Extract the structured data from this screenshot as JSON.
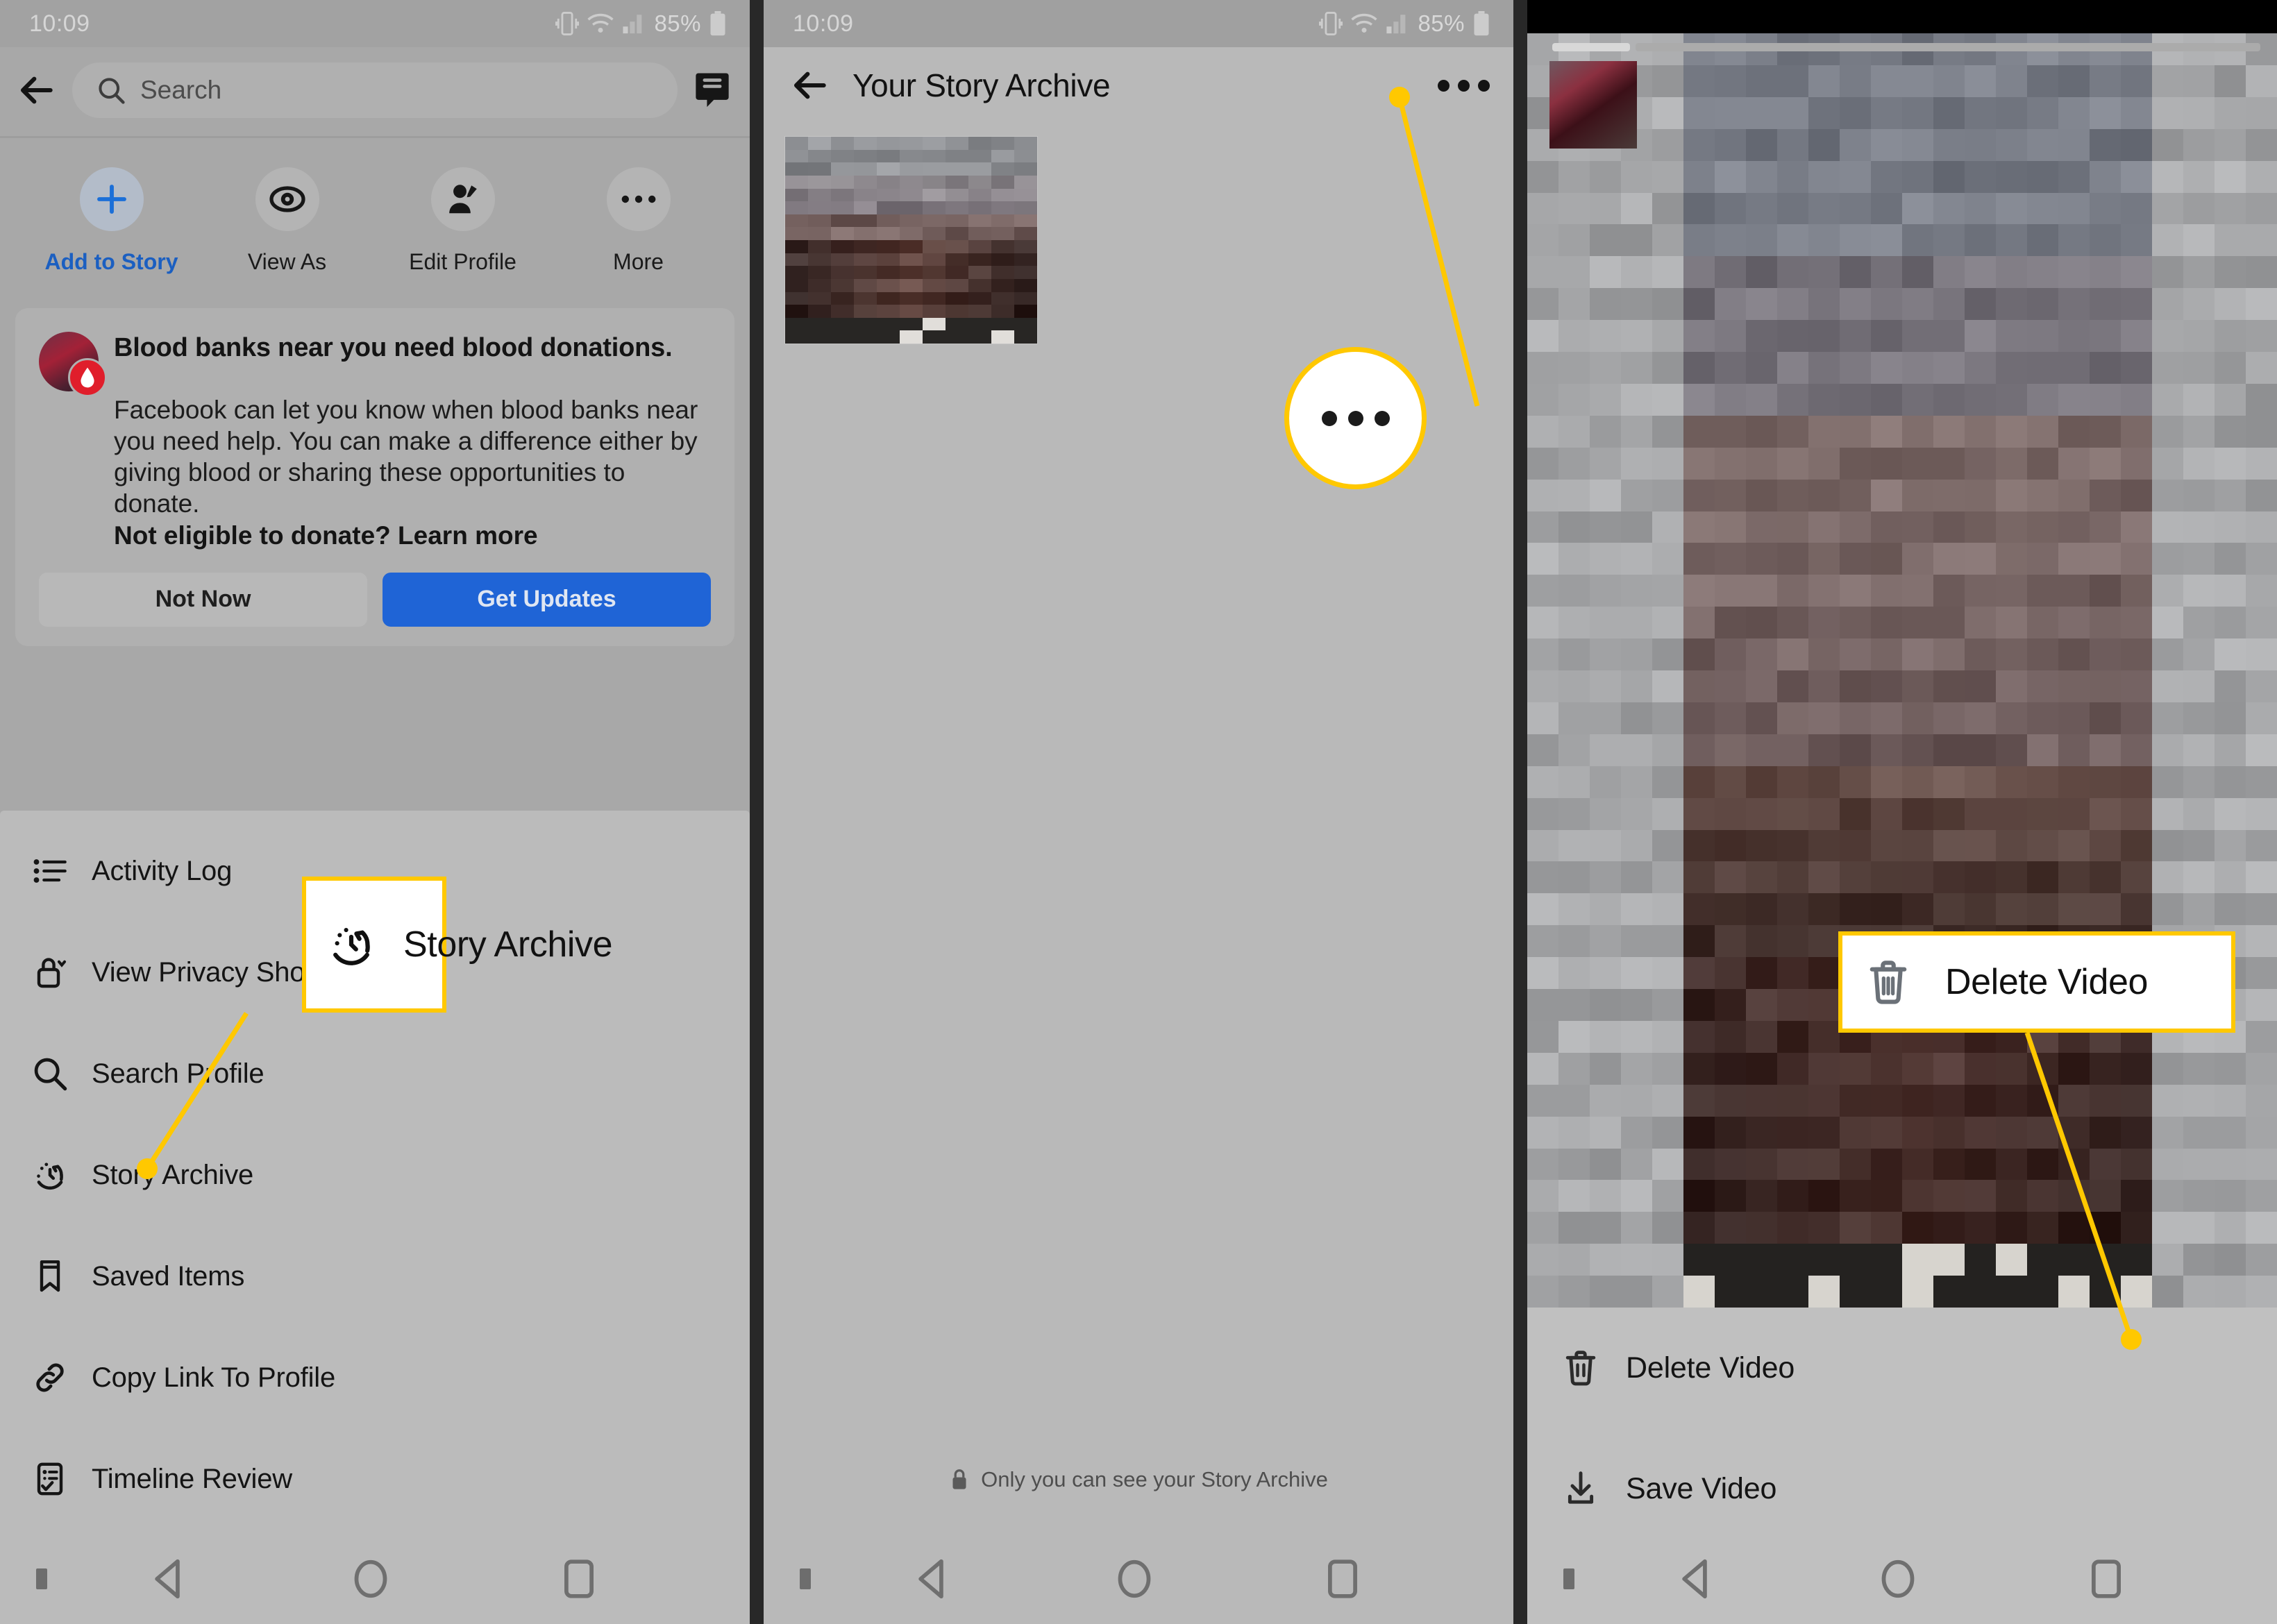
{
  "status_bar": {
    "time": "10:09",
    "battery": "85%"
  },
  "panel1": {
    "name": "facebook-profile-screen",
    "search": {
      "placeholder": "Search"
    },
    "icons": {
      "back": "back-arrow-icon",
      "messenger": "messenger-icon"
    },
    "actions": [
      {
        "label": "Add to Story",
        "icon": "plus-icon",
        "accent": true
      },
      {
        "label": "View As",
        "icon": "eye-icon",
        "accent": false
      },
      {
        "label": "Edit Profile",
        "icon": "edit-profile-icon",
        "accent": false
      },
      {
        "label": "More",
        "icon": "ellipsis-icon",
        "accent": false
      }
    ],
    "card": {
      "title": "Blood banks near you need blood donations.",
      "body": "Facebook can let you know when blood banks near you need help. You can make a difference either by giving blood or sharing these opportunities to donate.",
      "bold_line": "Not eligible to donate? Learn more",
      "secondary_button": "Not Now",
      "primary_button": "Get Updates",
      "primary_color": "#1f64d6"
    },
    "menu": [
      {
        "label": "Activity Log",
        "icon": "activity-log-icon"
      },
      {
        "label": "View Privacy Shortcuts",
        "icon": "lock-icon"
      },
      {
        "label": "Search Profile",
        "icon": "search-icon"
      },
      {
        "label": "Story Archive",
        "icon": "story-archive-icon"
      },
      {
        "label": "Saved Items",
        "icon": "bookmark-icon"
      },
      {
        "label": "Copy Link To Profile",
        "icon": "link-icon"
      },
      {
        "label": "Timeline Review",
        "icon": "timeline-review-icon"
      }
    ],
    "callout": {
      "label": "Story Archive",
      "icon": "story-archive-icon",
      "color": "#ffc800"
    }
  },
  "panel2": {
    "name": "your-story-archive-screen",
    "title": "Your Story Archive",
    "icons": {
      "back": "back-arrow-icon",
      "overflow": "ellipsis-icon"
    },
    "privacy_note": "Only you can see your Story Archive",
    "privacy_icon": "lock-icon",
    "callout": {
      "icon": "ellipsis-icon",
      "color": "#ffc800"
    }
  },
  "panel3": {
    "name": "story-video-viewer-screen",
    "menu": [
      {
        "label": "Delete Video",
        "icon": "trash-icon"
      },
      {
        "label": "Save Video",
        "icon": "download-icon"
      }
    ],
    "callout": {
      "label": "Delete Video",
      "icon": "trash-icon",
      "color": "#ffc800"
    }
  },
  "nav_bar": {
    "items": [
      {
        "label": "back",
        "icon": "nav-back-icon"
      },
      {
        "label": "home",
        "icon": "nav-home-icon"
      },
      {
        "label": "recents",
        "icon": "nav-recents-icon"
      }
    ]
  }
}
